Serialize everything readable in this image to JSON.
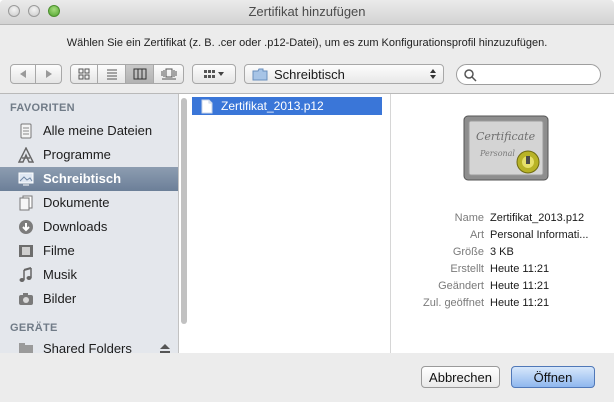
{
  "window": {
    "title": "Zertifikat hinzufügen"
  },
  "message": "Wählen Sie ein Zertifikat (z. B. .cer oder .p12-Datei), um es zum Konfigurationsprofil hinzuzufügen.",
  "toolbar": {
    "path": "Schreibtisch",
    "search_placeholder": ""
  },
  "sidebar": {
    "favorites_header": "FAVORITEN",
    "favorites": [
      {
        "label": "Alle meine Dateien",
        "icon": "all-files-icon"
      },
      {
        "label": "Programme",
        "icon": "applications-icon"
      },
      {
        "label": "Schreibtisch",
        "icon": "desktop-icon"
      },
      {
        "label": "Dokumente",
        "icon": "documents-icon"
      },
      {
        "label": "Downloads",
        "icon": "downloads-icon"
      },
      {
        "label": "Filme",
        "icon": "movies-icon"
      },
      {
        "label": "Musik",
        "icon": "music-icon"
      },
      {
        "label": "Bilder",
        "icon": "pictures-icon"
      }
    ],
    "selected": "Schreibtisch",
    "devices_header": "GERÄTE",
    "devices": [
      {
        "label": "Shared Folders",
        "icon": "shared-folder-icon"
      }
    ]
  },
  "files": [
    {
      "name": "Zertifikat_2013.p12",
      "selected": true
    }
  ],
  "preview": {
    "image_text_1": "Certificate",
    "image_text_2": "Personal",
    "rows": [
      {
        "key": "Name",
        "value": "Zertifikat_2013.p12"
      },
      {
        "key": "Art",
        "value": "Personal Informati..."
      },
      {
        "key": "Größe",
        "value": "3 KB"
      },
      {
        "key": "Erstellt",
        "value": "Heute 11:21"
      },
      {
        "key": "Geändert",
        "value": "Heute 11:21"
      },
      {
        "key": "Zul. geöffnet",
        "value": "Heute 11:21"
      }
    ]
  },
  "buttons": {
    "cancel": "Abbrechen",
    "open": "Öffnen"
  },
  "colors": {
    "selection": "#3a76d8",
    "sidebar_selection": "#6c7f98",
    "primary_button": "#8fb7ee"
  }
}
